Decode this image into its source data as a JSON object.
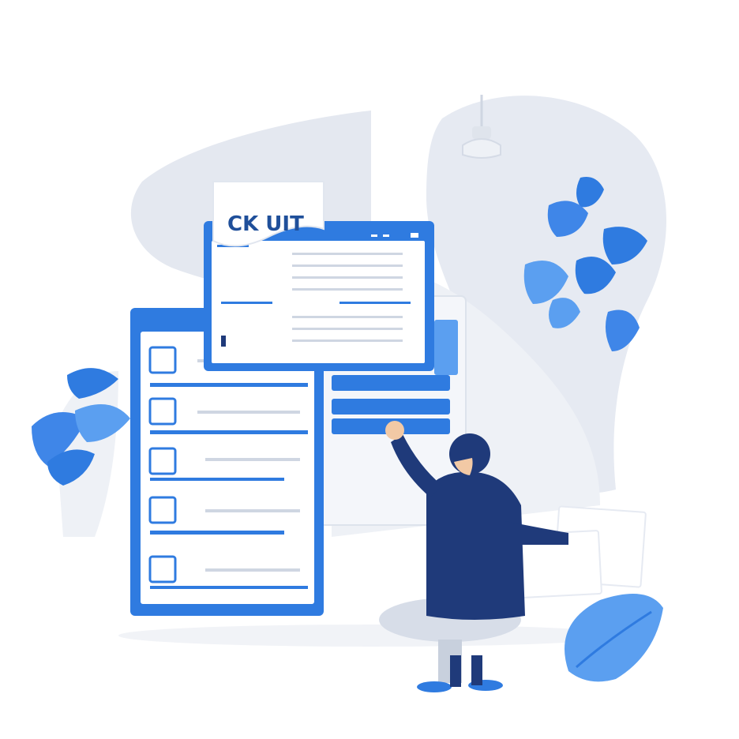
{
  "illustration": {
    "card_label": "CK UIT"
  },
  "colors": {
    "primary_blue": "#2f7be0",
    "light_blue": "#5b9ff0",
    "navy": "#1f3a7a",
    "pale_gray": "#e6eaf2",
    "mid_gray": "#cfd6e2",
    "white": "#ffffff"
  },
  "icons": [
    "folder-icon",
    "leaf-icon",
    "pendant-lamp-icon"
  ]
}
